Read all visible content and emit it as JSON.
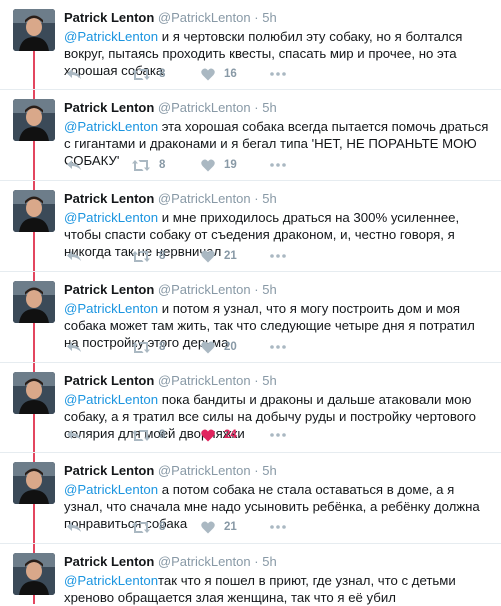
{
  "tweets": [
    {
      "name": "Patrick Lenton",
      "handle": "@PatrickLenton",
      "time": "5h",
      "mention": "@PatrickLenton",
      "text": " и я чертовски полюбил эту собаку, но я болтался вокруг, пытаясь проходить квесты, спасать мир и прочее, но эта хорошая собака",
      "retweets": "8",
      "likes": "16"
    },
    {
      "name": "Patrick Lenton",
      "handle": "@PatrickLenton",
      "time": "5h",
      "mention": "@PatrickLenton",
      "text": " эта хорошая собака всегда пытается помочь драться с гигантами и драконами и я бегал типа 'НЕТ, НЕ ПОРАНЬТЕ МОЮ СОБАКУ'",
      "retweets": "8",
      "likes": "19"
    },
    {
      "name": "Patrick Lenton",
      "handle": "@PatrickLenton",
      "time": "5h",
      "mention": "@PatrickLenton",
      "text": " и мне приходилось драться на 300% усиленнее, чтобы спасти собаку от съедения драконом, и, честно говоря, я никогда так не нервничал",
      "retweets": "8",
      "likes": "21"
    },
    {
      "name": "Patrick Lenton",
      "handle": "@PatrickLenton",
      "time": "5h",
      "mention": "@PatrickLenton",
      "text": " и потом я узнал, что я могу построить дом и моя собака может там жить, так что следующие четыре дня я потратил на постройку этого дерьма",
      "retweets": "8",
      "likes": "20"
    },
    {
      "name": "Patrick Lenton",
      "handle": "@PatrickLenton",
      "time": "5h",
      "mention": "@PatrickLenton",
      "text": " пока бандиты и драконы и дальше атаковали мою собаку, а я тратил все силы на добычу руды и постройку чертового солярия для моей дворняжки",
      "retweets": "8",
      "likes": "24",
      "liked": true
    },
    {
      "name": "Patrick Lenton",
      "handle": "@PatrickLenton",
      "time": "5h",
      "mention": "@PatrickLenton",
      "text": " а потом собака не стала оставаться в доме, а я узнал, что сначала мне надо усыновить ребёнка, а ребёнку должна понравиться собака",
      "retweets": "8",
      "likes": "21"
    },
    {
      "name": "Patrick Lenton",
      "handle": "@PatrickLenton",
      "time": "5h",
      "mention": "@PatrickLenton",
      "text": "так что я пошел в приют, где узнал, что с детьми хреново обращается злая женщина, так что я её убил"
    }
  ],
  "colors": {
    "thread_line": "#e3465f",
    "mention": "#1b95e0",
    "muted": "#8899a6",
    "like_active": "#e0245e"
  },
  "icons": [
    "avatar-photo",
    "reply-icon",
    "retweet-icon",
    "heart-icon",
    "more-dots-icon"
  ]
}
